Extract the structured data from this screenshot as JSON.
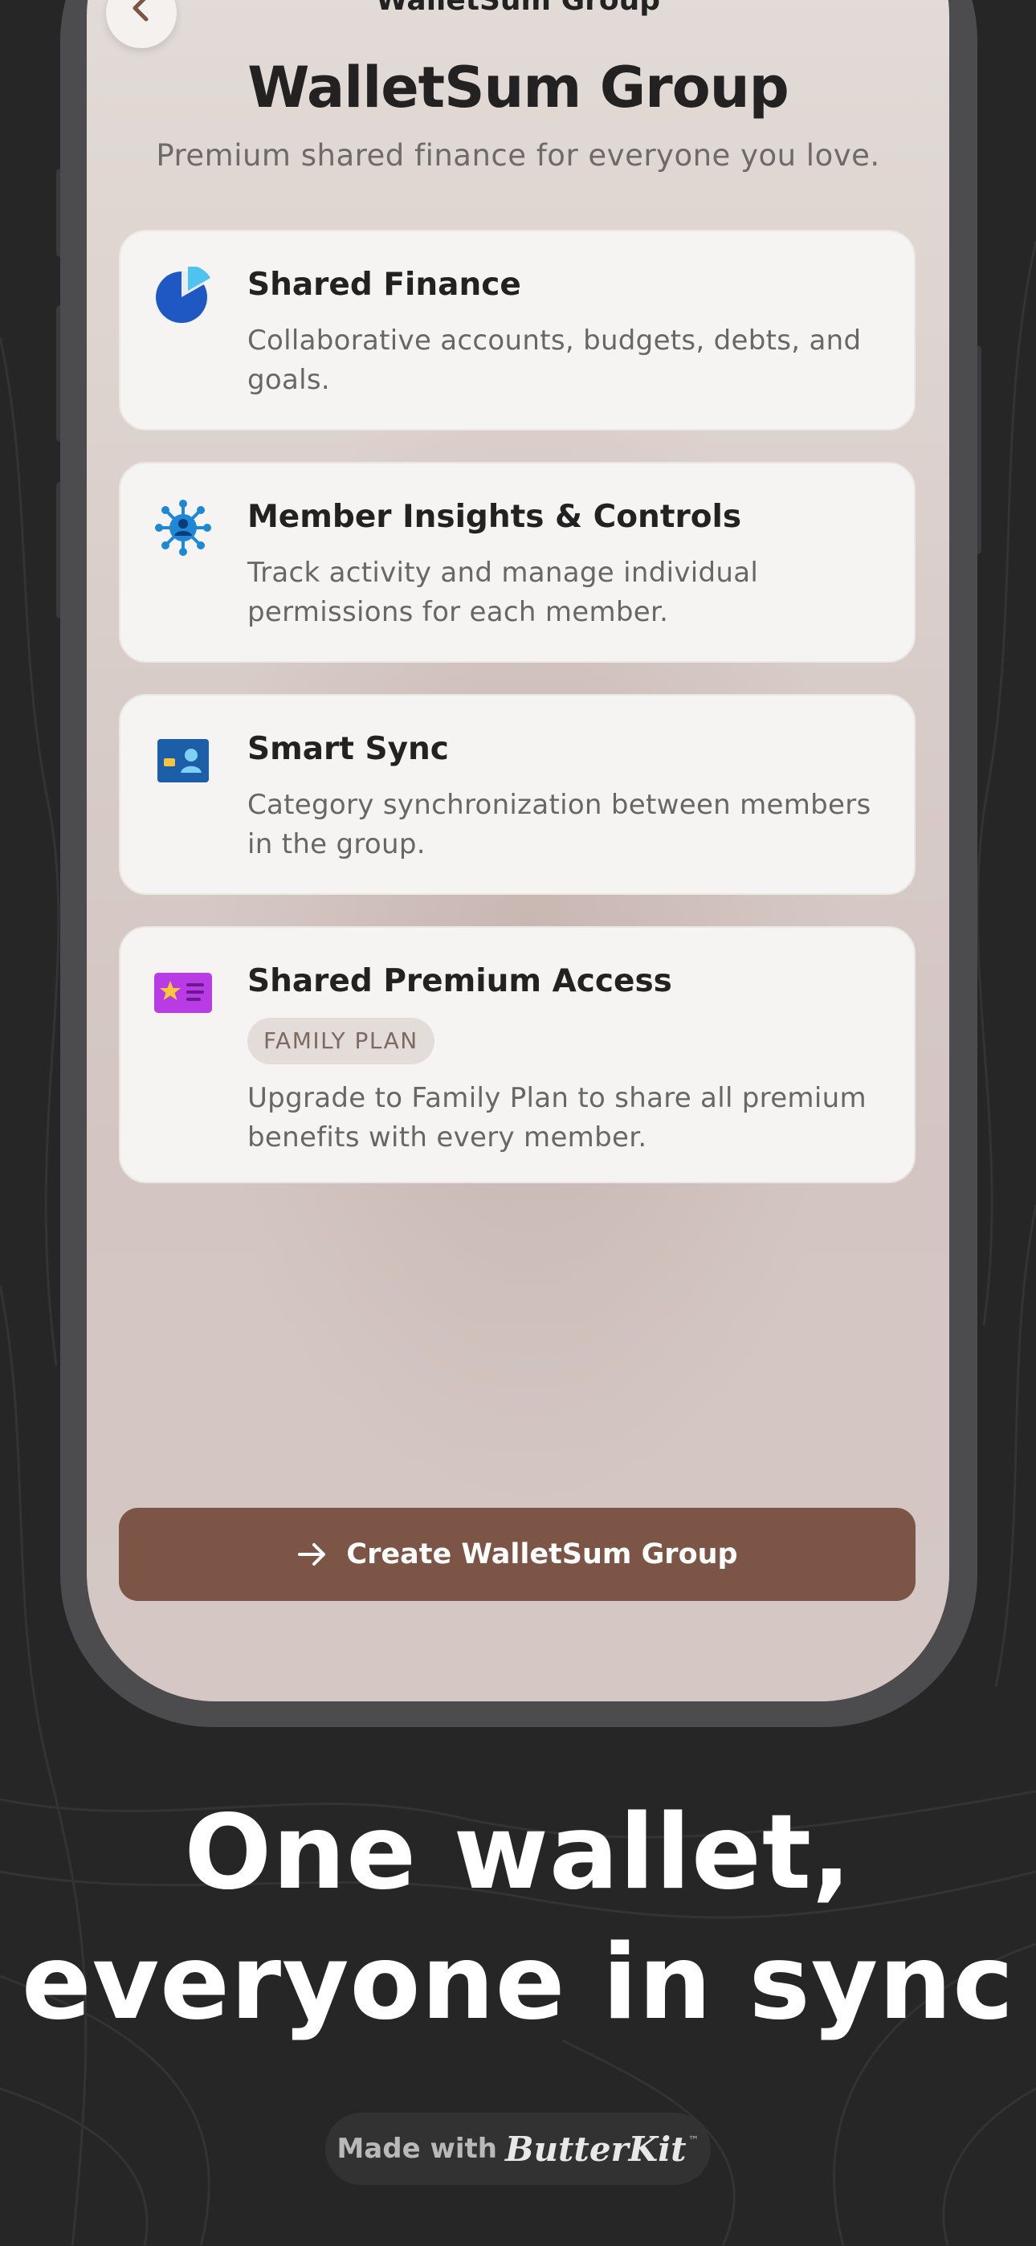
{
  "screen": {
    "nav_title": "WalletSum Group",
    "title": "WalletSum Group",
    "subtitle": "Premium shared finance for everyone you love."
  },
  "features": [
    {
      "title": "Shared Finance",
      "description": "Collaborative accounts, budgets, debts, and goals.",
      "icon": "pie-chart-icon"
    },
    {
      "title": "Member Insights & Controls",
      "description": "Track activity and manage individual permissions for each member.",
      "icon": "member-network-icon"
    },
    {
      "title": "Smart Sync",
      "description": "Category synchronization between members in the group.",
      "icon": "contact-card-icon"
    },
    {
      "title": "Shared Premium Access",
      "badge": "FAMILY PLAN",
      "description": "Upgrade to Family Plan to share all premium benefits with every member.",
      "icon": "star-card-icon"
    }
  ],
  "cta": {
    "label": "Create WalletSum Group",
    "icon": "arrow-right-icon"
  },
  "headline": {
    "line1": "One wallet,",
    "line2": "everyone in sync"
  },
  "footer": {
    "made_with": "Made with",
    "brand": "ButterKit",
    "brand_mark": "™"
  },
  "colors": {
    "background": "#262626",
    "accent": "#7c5546",
    "card": "#f5f4f3"
  }
}
